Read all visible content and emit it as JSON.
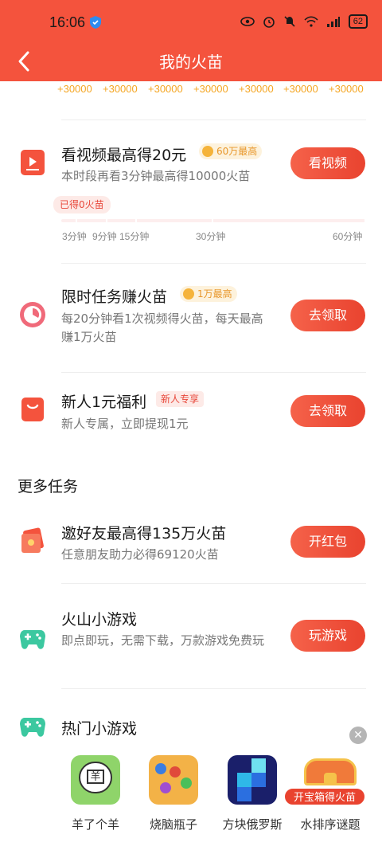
{
  "status": {
    "time": "16:06",
    "battery": "62"
  },
  "nav": {
    "title": "我的火苗"
  },
  "rewards": [
    "+30000",
    "+30000",
    "+30000",
    "+30000",
    "+30000",
    "+30000",
    "+30000"
  ],
  "video_task": {
    "title": "看视频最高得20元",
    "badge": "60万最高",
    "desc": "本时段再看3分钟最高得10000火苗",
    "button": "看视频",
    "earned": "已得0火苗",
    "time_labels": [
      "3分钟",
      "9分钟",
      "15分钟",
      "30分钟",
      "60分钟"
    ],
    "progress": 0
  },
  "limited_task": {
    "title": "限时任务赚火苗",
    "badge": "1万最高",
    "desc": "每20分钟看1次视频得火苗，每天最高赚1万火苗",
    "button": "去领取"
  },
  "newbie_task": {
    "title": "新人1元福利",
    "tag": "新人专享",
    "desc": "新人专属，立即提现1元",
    "button": "去领取"
  },
  "more": {
    "section_title": "更多任务",
    "invite": {
      "title": "邀好友最高得135万火苗",
      "desc": "任意朋友助力必得69120火苗",
      "button": "开红包"
    },
    "volcano_games": {
      "title": "火山小游戏",
      "desc": "即点即玩，无需下载，万款游戏免费玩",
      "button": "玩游戏"
    },
    "hot_games": {
      "title": "热门小游戏"
    }
  },
  "games": [
    {
      "name": "羊了个羊",
      "icon": "sheep-game-icon"
    },
    {
      "name": "烧脑瓶子",
      "icon": "bottle-game-icon"
    },
    {
      "name": "方块俄罗斯",
      "icon": "block-game-icon"
    },
    {
      "name": "水排序谜题",
      "icon": "water-sort-game-icon"
    }
  ],
  "chest": {
    "label": "开宝箱得火苗"
  },
  "colors": {
    "brand": "#f4533d",
    "gold": "#f5a623",
    "green": "#3cc8a0"
  }
}
